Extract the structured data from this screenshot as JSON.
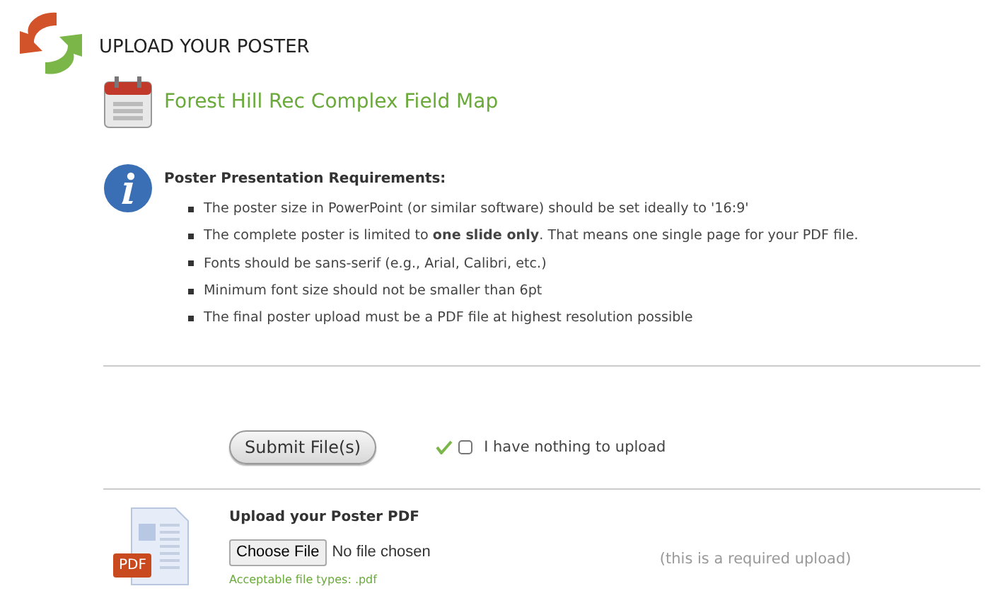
{
  "header": {
    "title": "UPLOAD YOUR POSTER"
  },
  "event": {
    "title": "Forest Hill Rec Complex Field Map"
  },
  "requirements": {
    "heading": "Poster Presentation Requirements:",
    "items": [
      "The poster size in PowerPoint (or similar software) should be set ideally to '16:9'",
      "The complete poster is limited to **one slide only**. That means one single page for your PDF file.",
      "Fonts should be sans-serif (e.g., Arial, Calibri, etc.)",
      "Minimum font size should not be smaller than 6pt",
      "The final poster upload must be a PDF file at highest resolution possible"
    ]
  },
  "submit": {
    "button": "Submit File(s)",
    "nothing_to_upload": {
      "label": "I have nothing to upload",
      "checked": false
    }
  },
  "upload": {
    "label": "Upload your Poster PDF",
    "file_button": "Choose File",
    "file_status": "No file chosen",
    "required_note": "(this is a required upload)",
    "file_types": "Acceptable file types: .pdf",
    "badge": "PDF"
  }
}
